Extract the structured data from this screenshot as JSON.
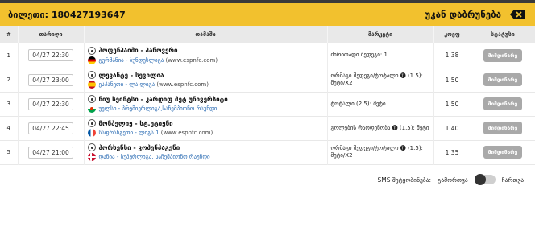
{
  "header": {
    "ticket_label": "ბილეთი:",
    "ticket_number": "180427193647",
    "back_label": "უკან დაბრუნება"
  },
  "table": {
    "columns": [
      "#",
      "თარიღი",
      "თამაში",
      "მარკეტი",
      "კოეფ",
      "სტატუსი"
    ],
    "rows": [
      {
        "num": "1",
        "date": "04/27 22:30",
        "match": "ჰოფენჰაიმი - ჰანოვერი",
        "league": "გერმანია - ბუნდესლიგა",
        "site": "(www.espnfc.com)",
        "market_text": "ძირითადი შედეგი: 1",
        "odds": "1.38",
        "status": "მიმდინარე"
      },
      {
        "num": "2",
        "date": "04/27 23:00",
        "match": "ლევანტე - სევილია",
        "league": "ესპანეთი - ლა ლიგა",
        "site": "(www.espnfc.com)",
        "market_text": "ორმაგი შედეგი/ტოტალი ⓫ (1.5): მეტი/X2",
        "odds": "1.50",
        "status": "მიმდინარე"
      },
      {
        "num": "3",
        "date": "04/27 22:30",
        "match": "ნიუ სეინტსი - კარდიფ მეტ უნივერსიტი",
        "league": "უელსი - პრემიერლიგა,საჩემპიონო რაუნდი",
        "site": "",
        "market_text": "ტოტალი (2.5): მეტი",
        "odds": "1.50",
        "status": "მიმდინარე"
      },
      {
        "num": "4",
        "date": "04/27 22:45",
        "match": "მონპელიე - სტ.ეტიენი",
        "league": "საფრანგეთი - ლიგა 1",
        "site": "(www.espnfc.com)",
        "market_text": "გოლების რაოდენობა ⓫ (1.5): მეტი",
        "odds": "1.40",
        "status": "მიმდინარე"
      },
      {
        "num": "5",
        "date": "04/27 21:00",
        "match": "ჰორსენსი - კოპენჰაგენი",
        "league": "დანია - სუპერლიგა. საჩემპიონო რაუნდი",
        "site": "",
        "market_text": "ორმაგი შედეგი/ტოტალი ⓫ (1.5): მეტი/X2",
        "odds": "1.35",
        "status": "მიმდინარე"
      }
    ]
  },
  "sms": {
    "label": "SMS შეტყობინება:",
    "off_label": "გამორთვა",
    "on_label": "ჩართვა"
  },
  "colors": {
    "header_bg": "#f2c12e",
    "link": "#2a6bb3",
    "status_btn": "#a9a9a9"
  }
}
